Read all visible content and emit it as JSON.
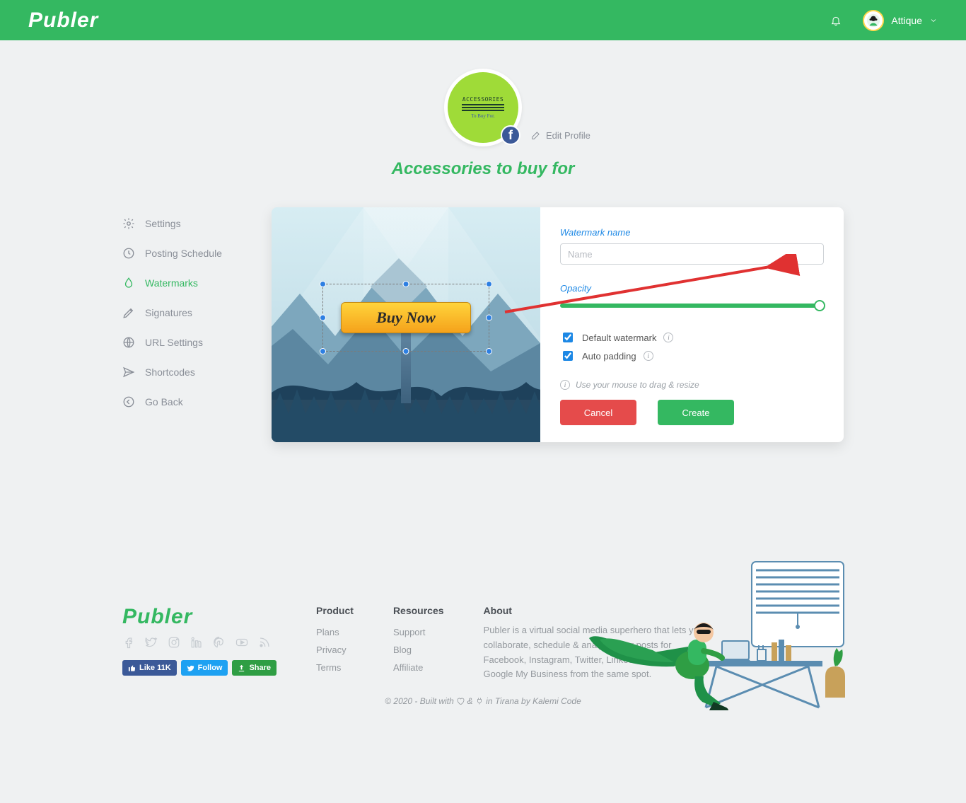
{
  "topbar": {
    "brand": "Publer",
    "username": "Attique"
  },
  "profile": {
    "name": "Accessories to buy for",
    "edit_label": "Edit Profile",
    "icon_title": "ACCESSORIES",
    "icon_sub": "To Buy For."
  },
  "sidenav": {
    "items": [
      {
        "id": "settings",
        "label": "Settings",
        "active": false
      },
      {
        "id": "posting-schedule",
        "label": "Posting Schedule",
        "active": false
      },
      {
        "id": "watermarks",
        "label": "Watermarks",
        "active": true
      },
      {
        "id": "signatures",
        "label": "Signatures",
        "active": false
      },
      {
        "id": "url-settings",
        "label": "URL Settings",
        "active": false
      },
      {
        "id": "shortcodes",
        "label": "Shortcodes",
        "active": false
      },
      {
        "id": "go-back",
        "label": "Go Back",
        "active": false
      }
    ]
  },
  "preview": {
    "billboard_text": "Buy Now"
  },
  "form": {
    "name_label": "Watermark name",
    "name_placeholder": "Name",
    "name_value": "",
    "opacity_label": "Opacity",
    "opacity_value": 100,
    "default_label": "Default watermark",
    "default_checked": true,
    "autopad_label": "Auto padding",
    "autopad_checked": true,
    "hint": "Use your mouse to drag & resize",
    "cancel": "Cancel",
    "create": "Create"
  },
  "footer": {
    "brand": "Publer",
    "product_head": "Product",
    "product_links": [
      "Plans",
      "Privacy",
      "Terms"
    ],
    "resources_head": "Resources",
    "resources_links": [
      "Support",
      "Blog",
      "Affiliate"
    ],
    "about_head": "About",
    "about_text": "Publer is a virtual social media superhero that lets you collaborate, schedule & analyze your posts for Facebook, Instagram, Twitter, LinkedIn, Pinterest & Google My Business from the same spot.",
    "like_label": "Like 11K",
    "follow_label": "Follow",
    "share_label": "Share",
    "credit_prefix": "© 2020 - Built with ",
    "credit_mid": " & ",
    "credit_suffix": " in Tirana by Kalemi Code"
  }
}
